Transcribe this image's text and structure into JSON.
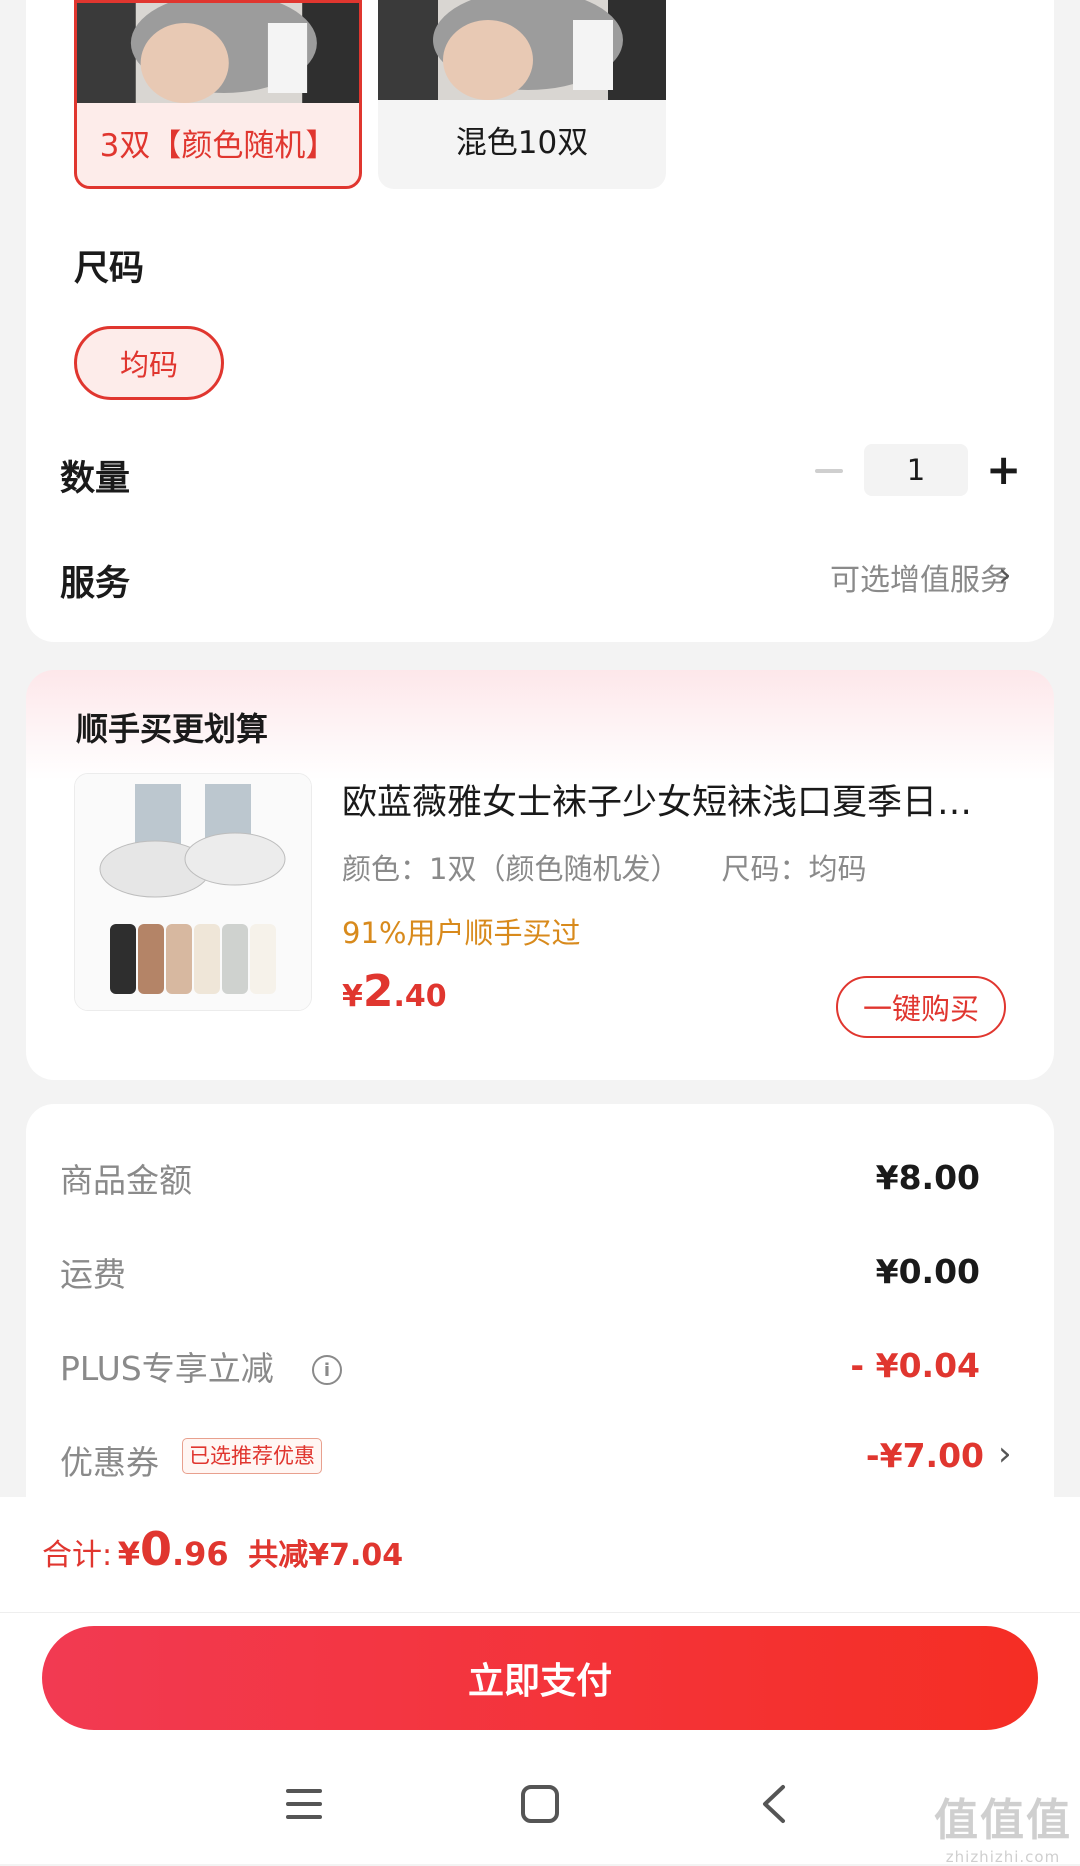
{
  "spec_options": [
    {
      "label": "3双【颜色随机】",
      "selected": true
    },
    {
      "label": "混色10双",
      "selected": false
    }
  ],
  "size": {
    "title": "尺码",
    "options": [
      {
        "label": "均码",
        "selected": true
      }
    ]
  },
  "quantity": {
    "label": "数量",
    "value": "1"
  },
  "service": {
    "label": "服务",
    "hint": "可选增值服务"
  },
  "upsell": {
    "title": "顺手买更划算",
    "product": {
      "name": "欧蓝薇雅女士袜子少女短袜浅口夏季日…",
      "color_spec": "颜色：1双（颜色随机发）",
      "size_spec": "尺码：均码",
      "social_proof": "91%用户顺手买过",
      "price_currency": "¥",
      "price_int": "2",
      "price_dec": ".40",
      "buy_label": "一键购买"
    }
  },
  "summary": {
    "items": [
      {
        "label": "商品金额",
        "value": "¥8.00"
      },
      {
        "label": "运费",
        "value": "¥0.00"
      },
      {
        "label": "PLUS专享立减",
        "value": "- ¥0.04"
      },
      {
        "label": "优惠券",
        "value": "-¥7.00"
      }
    ],
    "coupon_tag": "已选推荐优惠"
  },
  "total": {
    "label": "合计:",
    "currency": "¥",
    "int": "0",
    "dec": ".96",
    "saved": "共减¥7.04"
  },
  "pay_button": "立即支付",
  "watermark": {
    "big": "值值值",
    "small": "zhizhizhi.com"
  },
  "colors": {
    "accent": "#e0362f",
    "social_proof": "#d88a1c",
    "background": "#f3f3f3"
  }
}
